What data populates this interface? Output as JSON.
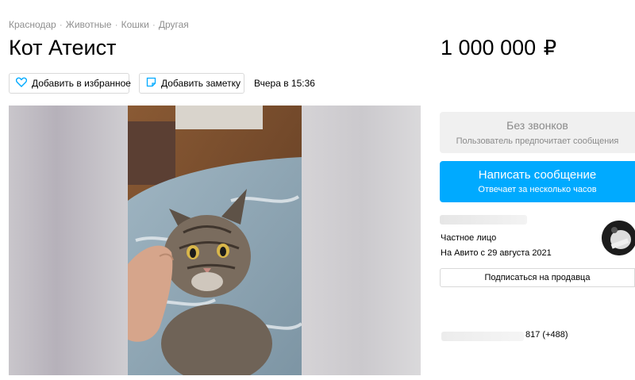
{
  "breadcrumb": [
    "Краснодар",
    "Животные",
    "Кошки",
    "Другая"
  ],
  "title": "Кот Атеист",
  "price": {
    "amount": "1 000 000",
    "currency": "₽"
  },
  "actions": {
    "favorite_label": "Добавить в избранное",
    "note_label": "Добавить заметку",
    "posted": "Вчера в 15:36"
  },
  "contact": {
    "no_calls_title": "Без звонков",
    "no_calls_sub": "Пользователь предпочитает сообщения",
    "message_title": "Написать сообщение",
    "message_sub": "Отвечает за несколько часов"
  },
  "seller": {
    "type": "Частное лицо",
    "since": "На Авито с 29 августа 2021",
    "subscribe_label": "Подписаться на продавца",
    "phone_visible": "817 (+488)"
  },
  "colors": {
    "accent": "#00aaff",
    "muted_bg": "#f0f0f0",
    "border": "#d9d9d9"
  },
  "icons": {
    "favorite": "heart-icon",
    "note": "note-icon"
  }
}
